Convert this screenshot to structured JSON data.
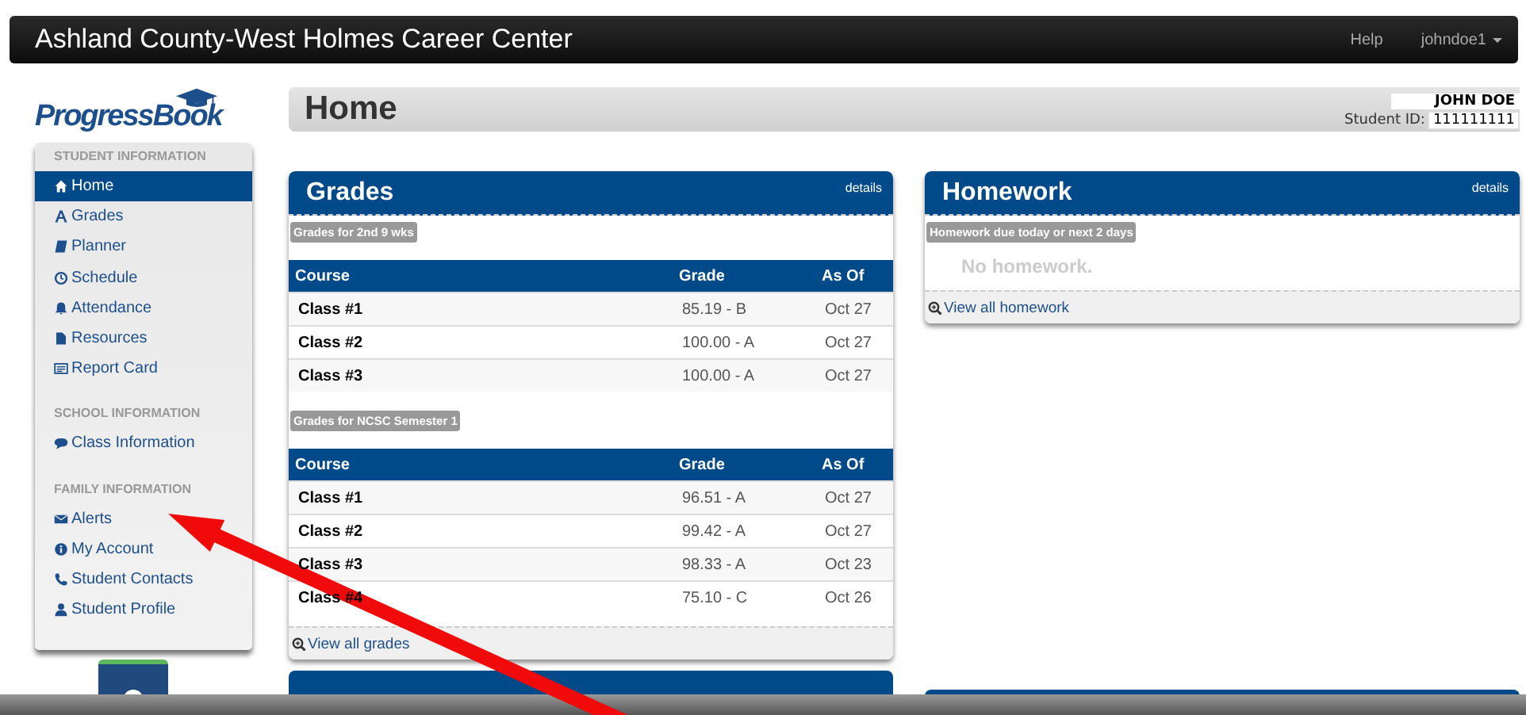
{
  "navbar": {
    "title": "Ashland County-West Holmes Career Center",
    "links": [
      "Help"
    ],
    "user": "johndoe1"
  },
  "logo": {
    "text": "ProgressBook"
  },
  "header": {
    "title": "Home",
    "student_name": "JOHN DOE",
    "student_id_label": "Student ID:",
    "student_id": "111111111"
  },
  "sidebar": {
    "sections": [
      {
        "heading": "STUDENT INFORMATION",
        "items": [
          {
            "label": "Home",
            "selected": true
          },
          {
            "label": "Grades",
            "selected": false
          },
          {
            "label": "Planner",
            "selected": false
          },
          {
            "label": "Schedule",
            "selected": false
          },
          {
            "label": "Attendance",
            "selected": false
          },
          {
            "label": "Resources",
            "selected": false
          },
          {
            "label": "Report Card",
            "selected": false
          }
        ]
      },
      {
        "heading": "SCHOOL INFORMATION",
        "items": [
          {
            "label": "Class Information",
            "selected": false
          }
        ]
      },
      {
        "heading": "FAMILY INFORMATION",
        "items": [
          {
            "label": "Alerts",
            "selected": false
          },
          {
            "label": "My Account",
            "selected": false
          },
          {
            "label": "Student Contacts",
            "selected": false
          },
          {
            "label": "Student Profile",
            "selected": false
          }
        ]
      }
    ]
  },
  "grades": {
    "title": "Grades",
    "details": "details",
    "groups": [
      {
        "caption": "Grades for 2nd 9 wks",
        "columns": [
          "Course",
          "Grade",
          "As Of"
        ],
        "rows": [
          [
            "Class #1",
            "85.19 - B",
            "Oct 27"
          ],
          [
            "Class #2",
            "100.00 - A",
            "Oct 27"
          ],
          [
            "Class #3",
            "100.00 - A",
            "Oct 27"
          ]
        ]
      },
      {
        "caption": "Grades for NCSC Semester 1",
        "columns": [
          "Course",
          "Grade",
          "As Of"
        ],
        "rows": [
          [
            "Class #1",
            "96.51 - A",
            "Oct 27"
          ],
          [
            "Class #2",
            "99.42 - A",
            "Oct 27"
          ],
          [
            "Class #3",
            "98.33 - A",
            "Oct 23"
          ],
          [
            "Class #4",
            "75.10 - C",
            "Oct 26"
          ]
        ]
      }
    ],
    "footer_link": "View all grades"
  },
  "homework": {
    "title": "Homework",
    "details": "details",
    "caption": "Homework due today or next 2 days",
    "empty": "No homework.",
    "footer_link": "View all homework"
  }
}
